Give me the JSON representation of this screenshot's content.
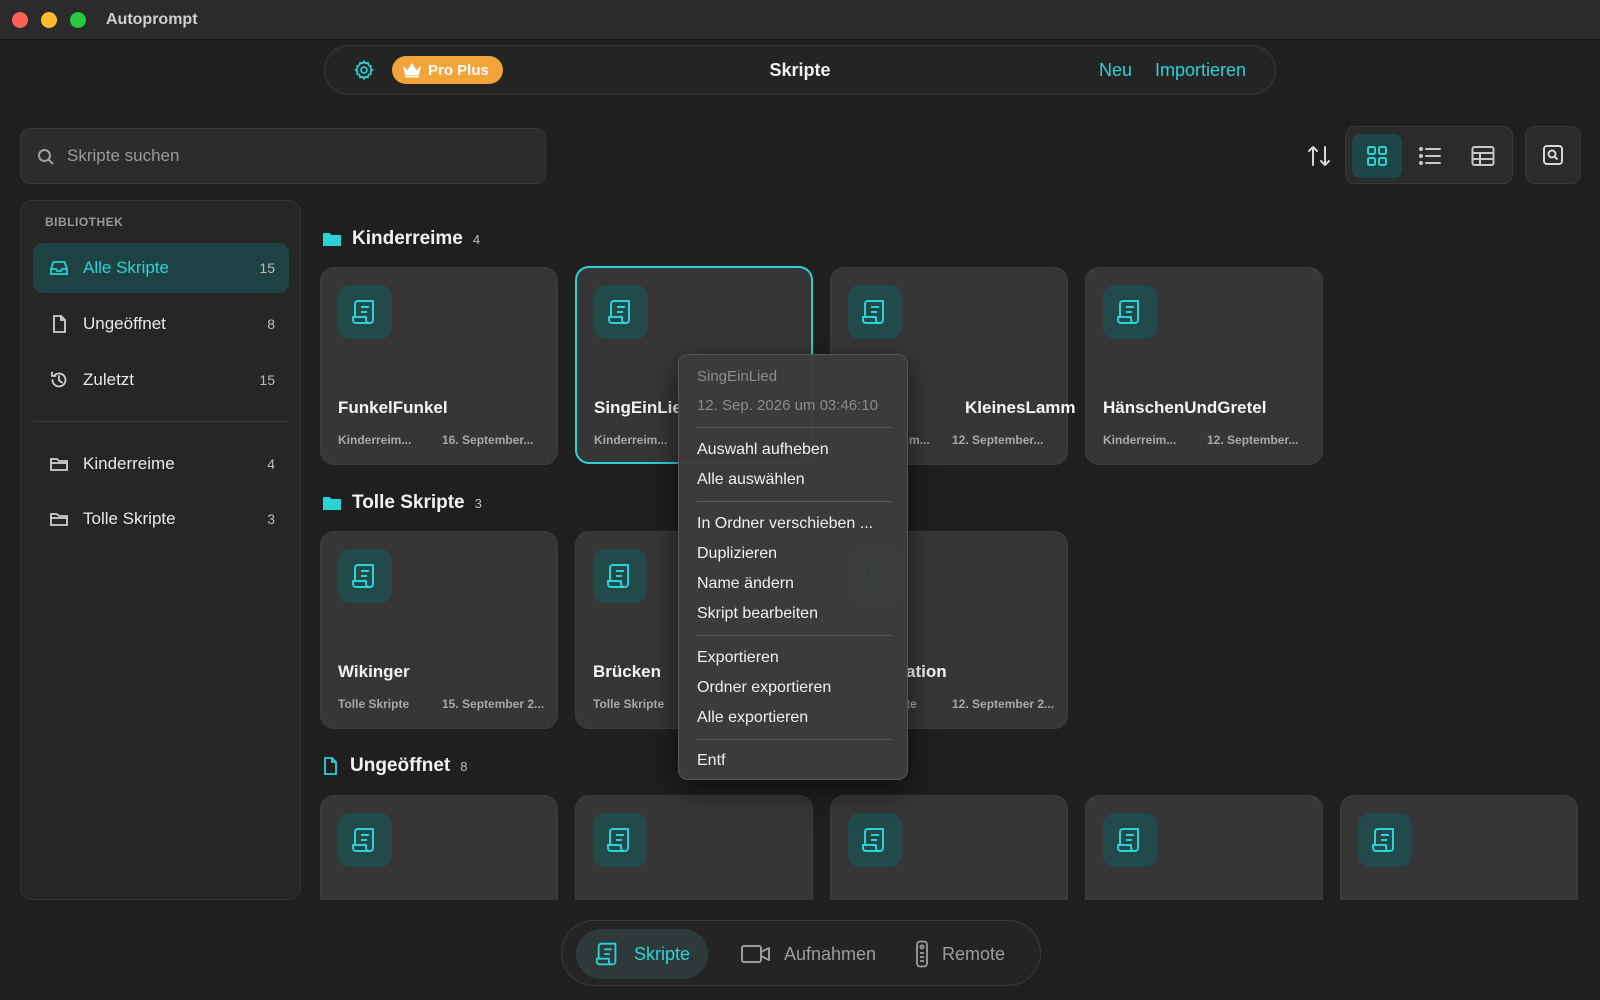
{
  "window": {
    "title": "Autoprompt"
  },
  "topbar": {
    "badge": "Pro Plus",
    "title": "Skripte",
    "new_label": "Neu",
    "import_label": "Importieren"
  },
  "search": {
    "placeholder": "Skripte suchen"
  },
  "sidebar": {
    "header": "BIBLIOTHEK",
    "library": [
      {
        "label": "Alle Skripte",
        "count": "15",
        "icon": "inbox-icon",
        "active": true
      },
      {
        "label": "Ungeöffnet",
        "count": "8",
        "icon": "document-icon"
      },
      {
        "label": "Zuletzt",
        "count": "15",
        "icon": "history-icon"
      }
    ],
    "folders": [
      {
        "label": "Kinderreime",
        "count": "4",
        "icon": "folder-icon"
      },
      {
        "label": "Tolle Skripte",
        "count": "3",
        "icon": "folder-icon"
      }
    ]
  },
  "sections": [
    {
      "title": "Kinderreime",
      "count": "4",
      "cards": [
        {
          "name": "FunkelFunkel",
          "folder": "Kinderreim...",
          "date": "16. September..."
        },
        {
          "name": "SingEinLie",
          "folder": "Kinderreim...",
          "date": "",
          "selected": true
        },
        {
          "name": "KleinesLamm",
          "folder": "m...",
          "date": "12. September..."
        },
        {
          "name": "HänschenUndGretel",
          "folder": "Kinderreim...",
          "date": "12. September..."
        }
      ]
    },
    {
      "title": "Tolle Skripte",
      "count": "3",
      "cards": [
        {
          "name": "Wikinger",
          "folder": "Tolle Skripte",
          "date": "15. September 2..."
        },
        {
          "name": "Brücken",
          "folder": "Tolle Skripte",
          "date": ""
        },
        {
          "name": "ation",
          "folder": "te",
          "date": "12. September 2..."
        }
      ]
    },
    {
      "title": "Ungeöffnet",
      "count": "8"
    }
  ],
  "context_menu": {
    "title": "SingEinLied",
    "subtitle": "12. Sep. 2026 um 03:46:10",
    "items": [
      "Auswahl aufheben",
      "Alle auswählen",
      "In Ordner verschieben ...",
      "Duplizieren",
      "Name ändern",
      "Skript bearbeiten",
      "Exportieren",
      "Ordner exportieren",
      "Alle exportieren",
      "Entf"
    ]
  },
  "bottom_tabs": [
    {
      "label": "Skripte",
      "icon": "script-icon",
      "active": true
    },
    {
      "label": "Aufnahmen",
      "icon": "video-camera-icon"
    },
    {
      "label": "Remote",
      "icon": "remote-icon"
    }
  ],
  "colors": {
    "accent": "#2cd3d6",
    "badge": "#f2a33a",
    "background": "#1f1f1f",
    "card": "#363636"
  }
}
